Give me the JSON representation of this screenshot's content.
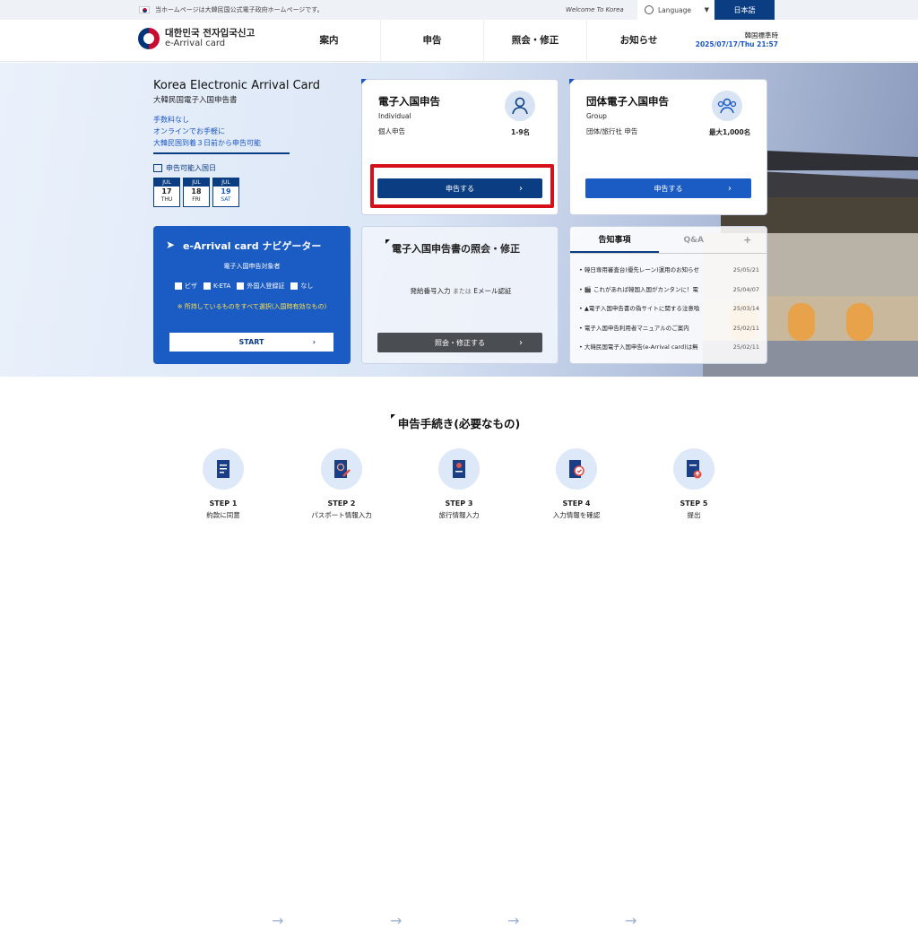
{
  "topbar": {
    "notice": "当ホームページは大韓民国公式電子政府ホームページです。",
    "welcome": "Welcome To Korea",
    "language_label": "Language",
    "language_selected": "日本語"
  },
  "header": {
    "logo_ko": "대한민국 전자입국신고",
    "logo_en": "e-Arrival card",
    "nav": [
      "案内",
      "申告",
      "照会・修正",
      "お知らせ"
    ],
    "clock_label": "韓国標準時",
    "clock_value": "2025/07/17/Thu 21:57"
  },
  "intro": {
    "title": "Korea Electronic Arrival Card",
    "subtitle": "大韓民国電子入国申告書",
    "features": [
      "手数料なし",
      "オンラインでお手軽に",
      "大韓民国到着３日前から申告可能"
    ],
    "dates_label": "申告可能入国日",
    "dates": [
      {
        "month": "JUL",
        "day": "17",
        "dow": "THU"
      },
      {
        "month": "JUL",
        "day": "18",
        "dow": "FRI"
      },
      {
        "month": "JUL",
        "day": "19",
        "dow": "SAT"
      }
    ]
  },
  "individual": {
    "title": "電子入国申告",
    "en": "Individual",
    "ja": "個人申告",
    "count": "1-9名",
    "button": "申告する"
  },
  "group": {
    "title": "団体電子入国申告",
    "en": "Group",
    "ja": "団体/旅行社 申告",
    "count": "最大1,000名",
    "button": "申告する"
  },
  "navigator": {
    "title": "e-Arrival card ナビゲーター",
    "target": "電子入国申告対象者",
    "options": [
      "ビザ",
      "K-ETA",
      "外国人登録証",
      "なし"
    ],
    "warning": "※ 所持しているものをすべて選択(入国時有効なもの)",
    "start": "START"
  },
  "inquiry": {
    "title": "電子入国申告書の照会・修正",
    "how_a": "発給番号入力",
    "how_or": "または",
    "how_b": "Eメール認証",
    "button": "照会・修正する"
  },
  "news": {
    "tabs": [
      "告知事項",
      "Q&A",
      "+"
    ],
    "items": [
      {
        "title": "• 韓日専用審査台(優先レーン)運用のお知らせ",
        "date": "25/05/21"
      },
      {
        "title": "• 🎬 これがあれば韓国入国がカンタンに！電",
        "date": "25/04/07"
      },
      {
        "title": "• ▲電子入国申告書の偽サイトに関する注意喚",
        "date": "25/03/14"
      },
      {
        "title": "• 電子入国申告利用者マニュアルのご案内",
        "date": "25/02/11"
      },
      {
        "title": "• 大韓民国電子入国申告(e-Arrival card)は無",
        "date": "25/02/11"
      }
    ]
  },
  "procedure": {
    "title": "申告手続き(必要なもの)",
    "steps": [
      {
        "step": "STEP 1",
        "desc": "約款に同意",
        "icon": "document-icon"
      },
      {
        "step": "STEP 2",
        "desc": "パスポート情報入力",
        "icon": "passport-icon"
      },
      {
        "step": "STEP 3",
        "desc": "旅行情報入力",
        "icon": "travel-info-icon"
      },
      {
        "step": "STEP 4",
        "desc": "入力情報を確認",
        "icon": "check-document-icon"
      },
      {
        "step": "STEP 5",
        "desc": "提出",
        "icon": "submit-icon"
      }
    ]
  },
  "colors": {
    "primary": "#0b3d82",
    "accent": "#1a5bc4",
    "highlight": "#d6101b"
  }
}
